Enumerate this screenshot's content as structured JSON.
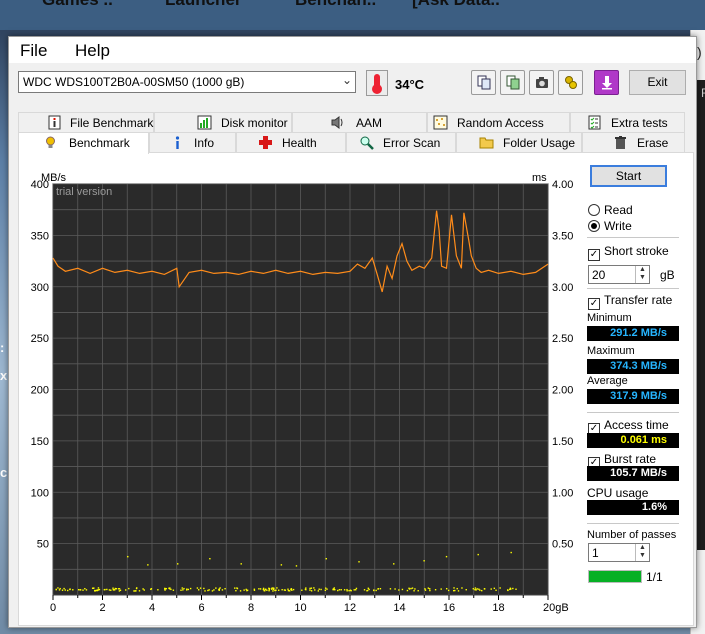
{
  "background": {
    "top_strip": [
      "Games ..",
      "Launcher",
      "Benchan..",
      "[Ask Data.."
    ],
    "right_tab": ")",
    "right_small": "F"
  },
  "menu": {
    "file": "File",
    "help": "Help"
  },
  "toolbar": {
    "drive": "WDC  WDS100T2B0A-00SM50 (1000 gB)",
    "temperature": "34°C",
    "exit_label": "Exit",
    "buttons": [
      "copy-icon",
      "copy-info-icon",
      "screenshot-camera-icon",
      "options-keys-icon",
      "save-down-arrow-icon"
    ]
  },
  "tabs": {
    "row1": [
      {
        "label": "File Benchmark",
        "icon": "info-doc-icon"
      },
      {
        "label": "Disk monitor",
        "icon": "monitor-chart-icon"
      },
      {
        "label": "AAM",
        "icon": "speaker-icon"
      },
      {
        "label": "Random Access",
        "icon": "random-dots-icon"
      },
      {
        "label": "Extra tests",
        "icon": "checklist-icon"
      }
    ],
    "row2": [
      {
        "label": "Benchmark",
        "icon": "bulb-icon",
        "active": true
      },
      {
        "label": "Info",
        "icon": "info-icon"
      },
      {
        "label": "Health",
        "icon": "health-cross-icon"
      },
      {
        "label": "Error Scan",
        "icon": "magnifier-icon"
      },
      {
        "label": "Folder Usage",
        "icon": "folder-icon"
      },
      {
        "label": "Erase",
        "icon": "trash-icon"
      }
    ]
  },
  "controls": {
    "start_label": "Start",
    "read_label": "Read",
    "write_label": "Write",
    "mode": "Write",
    "short_stroke_label": "Short stroke",
    "short_stroke_checked": true,
    "short_stroke_value": "20",
    "short_stroke_unit": "gB",
    "transfer_rate_label": "Transfer rate",
    "transfer_rate_checked": true,
    "minimum_label": "Minimum",
    "minimum_value": "291.2 MB/s",
    "maximum_label": "Maximum",
    "maximum_value": "374.3 MB/s",
    "average_label": "Average",
    "average_value": "317.9 MB/s",
    "access_time_label": "Access time",
    "access_time_checked": true,
    "access_time_value": "0.061 ms",
    "burst_rate_label": "Burst rate",
    "burst_rate_checked": true,
    "burst_rate_value": "105.7 MB/s",
    "cpu_usage_label": "CPU usage",
    "cpu_usage_value": "1.6%",
    "passes_label": "Number of passes",
    "passes_value": "1",
    "progress_fraction": 1.0,
    "progress_text": "1/1",
    "colors": {
      "transfer": "#26b5ff",
      "access": "#ffff00",
      "cpu": "#ffffff",
      "progress": "#06b025"
    }
  },
  "chart_data": {
    "type": "line",
    "watermark": "trial version",
    "ylabel_left": "MB/s",
    "ylabel_right": "ms",
    "xlabel": "gB",
    "xlim": [
      0,
      20
    ],
    "ylim_left": [
      0,
      400
    ],
    "ylim_right": [
      0,
      4.0
    ],
    "x_ticks": [
      "0",
      "2",
      "4",
      "6",
      "8",
      "10",
      "12",
      "14",
      "16",
      "18",
      "20gB"
    ],
    "y_ticks_left": [
      "400",
      "350",
      "300",
      "250",
      "200",
      "150",
      "100",
      "50"
    ],
    "y_ticks_right": [
      "4.00",
      "3.50",
      "3.00",
      "2.50",
      "2.00",
      "1.50",
      "1.00",
      "0.50"
    ],
    "grid": true,
    "background": "#2a2a2a",
    "series": [
      {
        "color": "#ff8c1a",
        "axis": "left",
        "x": [
          0,
          0.2,
          0.5,
          1,
          1.5,
          2,
          2.5,
          3,
          3.5,
          4,
          4.5,
          5,
          5.1,
          5.5,
          6,
          6.5,
          7,
          7.5,
          8,
          8.5,
          9,
          9.5,
          10,
          10.5,
          11,
          11.5,
          12,
          12.3,
          12.6,
          12.9,
          13.1,
          13.3,
          13.5,
          13.7,
          13.9,
          14.1,
          14.3,
          14.5,
          14.8,
          15,
          15.3,
          15.5,
          15.6,
          15.7,
          15.9,
          16.1,
          16.3,
          16.5,
          16.6,
          16.8,
          16.9,
          17.1,
          17.3,
          17.6,
          18,
          18.5,
          19,
          19.5,
          20
        ],
        "y": [
          328,
          320,
          315,
          318,
          313,
          318,
          314,
          316,
          313,
          315,
          312,
          318,
          300,
          314,
          316,
          313,
          314,
          312,
          315,
          313,
          316,
          313,
          315,
          312,
          314,
          313,
          315,
          322,
          318,
          328,
          312,
          295,
          320,
          308,
          330,
          342,
          325,
          316,
          320,
          318,
          328,
          374,
          355,
          320,
          318,
          370,
          330,
          318,
          372,
          345,
          330,
          318,
          314,
          316,
          313,
          315,
          312,
          314,
          322
        ]
      }
    ],
    "access_points": {
      "color": "#ffff00",
      "axis": "right",
      "baseline_ms": 0.061,
      "outliers_ms": [
        0.38,
        0.3,
        0.31,
        0.36,
        0.31,
        0.3,
        0.29,
        0.36,
        0.33,
        0.31,
        0.34,
        0.38,
        0.4,
        0.42
      ]
    }
  }
}
